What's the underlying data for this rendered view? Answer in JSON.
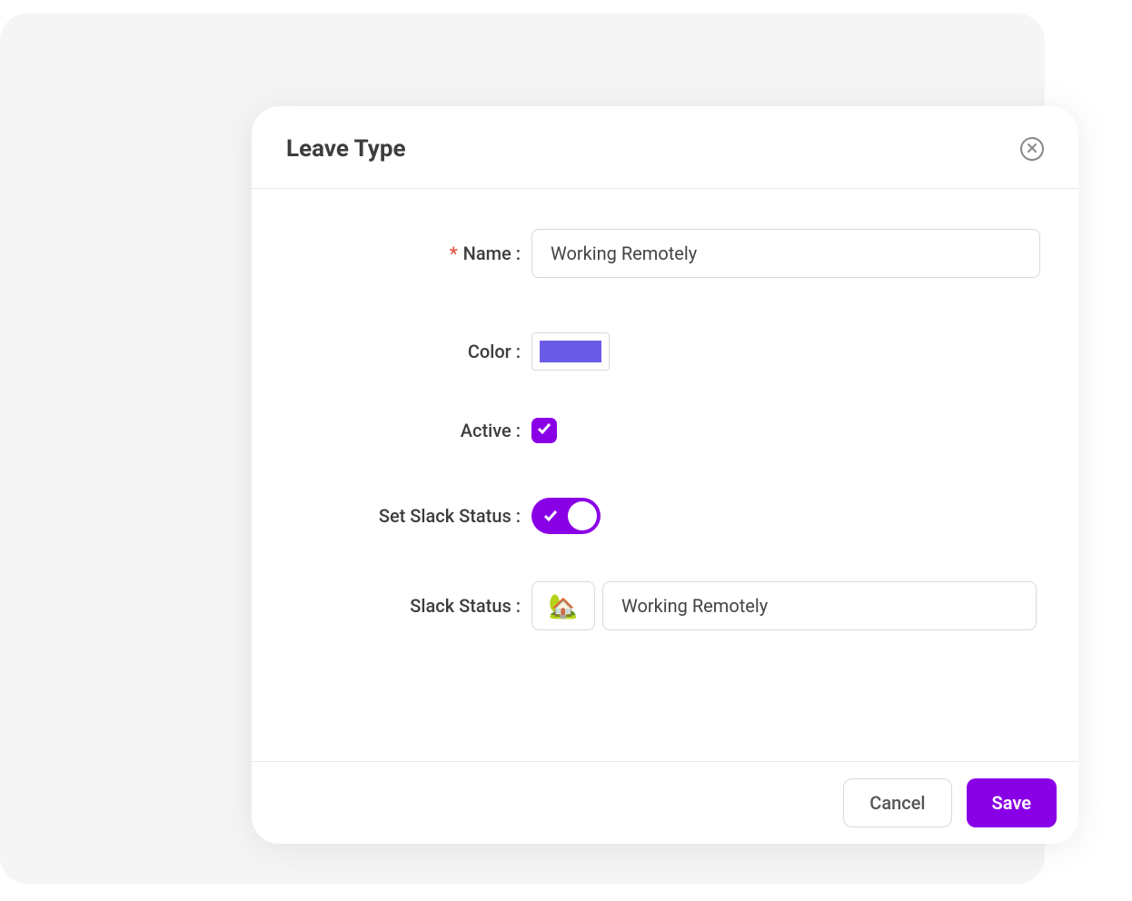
{
  "modal": {
    "title": "Leave Type",
    "fields": {
      "name": {
        "label": "Name",
        "required": true,
        "value": "Working Remotely"
      },
      "color": {
        "label": "Color",
        "value": "#6b5ce7"
      },
      "active": {
        "label": "Active",
        "checked": true
      },
      "set_slack_status": {
        "label": "Set Slack Status",
        "enabled": true
      },
      "slack_status": {
        "label": "Slack Status",
        "emoji": "🏡",
        "text": "Working Remotely"
      }
    },
    "buttons": {
      "cancel": "Cancel",
      "save": "Save"
    }
  }
}
